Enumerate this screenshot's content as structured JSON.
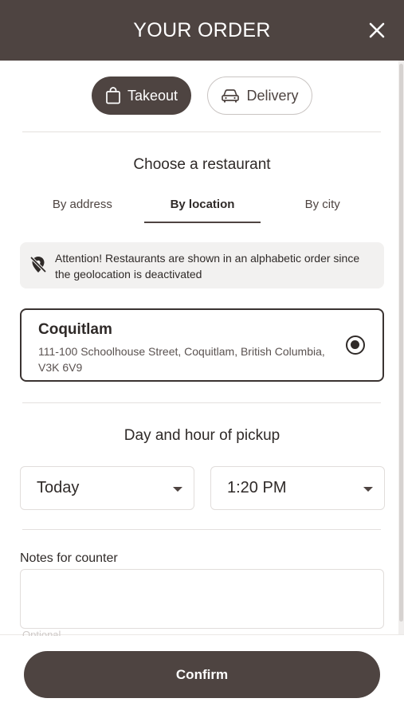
{
  "header": {
    "title": "YOUR ORDER",
    "close_icon": "close-icon"
  },
  "mode": {
    "takeout_label": "Takeout",
    "delivery_label": "Delivery",
    "selected": "takeout"
  },
  "restaurant_section": {
    "title": "Choose a restaurant",
    "tabs": [
      {
        "label": "By address",
        "active": false
      },
      {
        "label": "By location",
        "active": true
      },
      {
        "label": "By city",
        "active": false
      }
    ],
    "notice": "Attention! Restaurants are shown in an alphabetic order since the geolocation is deactivated",
    "restaurant": {
      "name": "Coquitlam",
      "address": "111-100 Schoolhouse Street, Coquitlam, British Columbia, V3K 6V9",
      "selected": true
    }
  },
  "pickup": {
    "title": "Day and hour of pickup",
    "day": "Today",
    "time": "1:20 PM"
  },
  "notes": {
    "label": "Notes for counter",
    "value": "",
    "hint": "Optional"
  },
  "footer": {
    "confirm_label": "Confirm"
  },
  "colors": {
    "primary": "#4e4441",
    "text": "#2f2a28",
    "notice_bg": "#f2f1f0",
    "border": "#e1dddb"
  }
}
